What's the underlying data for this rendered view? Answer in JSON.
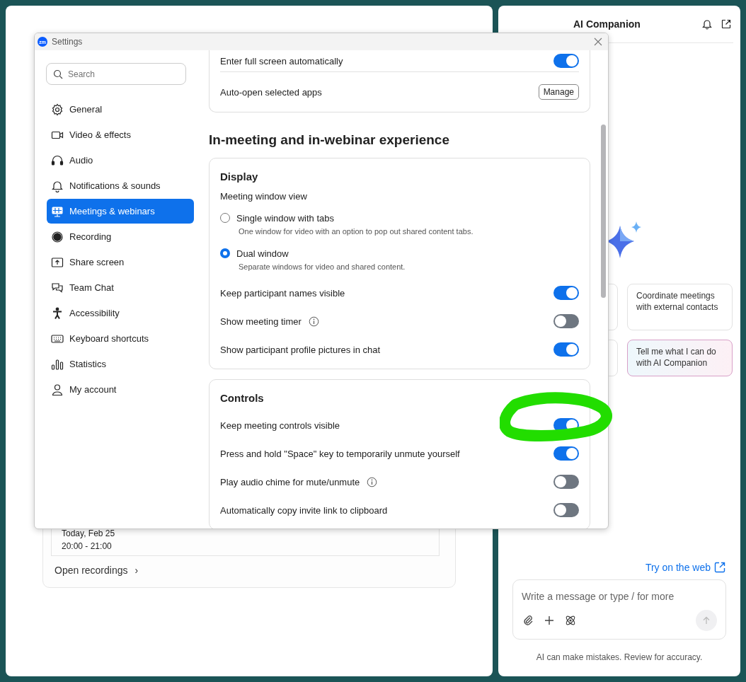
{
  "background_panel": {
    "meeting": {
      "date": "Today, Feb 25",
      "time": "20:00 - 21:00"
    },
    "open_recordings": "Open recordings",
    "chevron": "›"
  },
  "ai_panel": {
    "title": "AI Companion",
    "suggestions": [
      {
        "kind": "plain"
      },
      {
        "text": "Coordinate meetings with external contacts",
        "kind": "plain"
      },
      {
        "kind": "plain"
      },
      {
        "text": "Tell me what I can do with AI Companion",
        "kind": "gradient"
      }
    ],
    "web_link": "Try on the web",
    "input": {
      "placeholder": "Write a message or type / for more"
    },
    "disclaimer": "AI can make mistakes. Review for accuracy."
  },
  "settings": {
    "logo": "zm",
    "title": "Settings",
    "search": {
      "placeholder": "Search"
    },
    "nav": [
      {
        "label": "General",
        "selected": false
      },
      {
        "label": "Video & effects",
        "selected": false
      },
      {
        "label": "Audio",
        "selected": false
      },
      {
        "label": "Notifications & sounds",
        "selected": false
      },
      {
        "label": "Meetings & webinars",
        "selected": true
      },
      {
        "label": "Recording",
        "selected": false
      },
      {
        "label": "Share screen",
        "selected": false
      },
      {
        "label": "Team Chat",
        "selected": false
      },
      {
        "label": "Accessibility",
        "selected": false
      },
      {
        "label": "Keyboard shortcuts",
        "selected": false
      },
      {
        "label": "Statistics",
        "selected": false
      },
      {
        "label": "My account",
        "selected": false
      }
    ],
    "top_card": {
      "rows": [
        {
          "kind": "toggle",
          "label": "Enter full screen automatically",
          "on": true
        },
        {
          "kind": "button",
          "label": "Auto-open selected apps",
          "button": "Manage"
        }
      ]
    },
    "section_title": "In-meeting and in-webinar experience",
    "cards": [
      {
        "title": "Display",
        "subtitle": "Meeting window view",
        "rows": [
          {
            "kind": "radio",
            "label": "Single window with tabs",
            "description": "One window for video with an option to pop out shared content tabs.",
            "selected": false
          },
          {
            "kind": "radio",
            "label": "Dual window",
            "description": "Separate windows for video and shared content.",
            "selected": true
          },
          {
            "kind": "toggle",
            "label": "Keep participant names visible",
            "on": true,
            "info": false
          },
          {
            "kind": "toggle",
            "label": "Show meeting timer",
            "on": false,
            "info": true
          },
          {
            "kind": "toggle",
            "label": "Show participant profile pictures in chat",
            "on": true,
            "info": false
          }
        ]
      },
      {
        "title": "Controls",
        "rows": [
          {
            "kind": "toggle",
            "label": "Keep meeting controls visible",
            "on": true,
            "info": false
          },
          {
            "kind": "toggle",
            "label": "Press and hold \"Space\" key to temporarily unmute yourself",
            "on": true,
            "info": false
          },
          {
            "kind": "toggle",
            "label": "Play audio chime for mute/unmute",
            "on": false,
            "info": true
          },
          {
            "kind": "toggle",
            "label": "Automatically copy invite link to clipboard",
            "on": false,
            "info": false
          }
        ]
      }
    ]
  }
}
